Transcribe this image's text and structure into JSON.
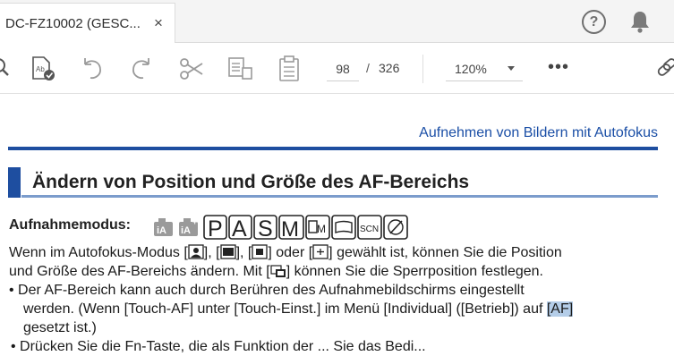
{
  "tab": {
    "title": "DC-FZ10002 (GESC...",
    "close": "×"
  },
  "header_icons": {
    "help": "?",
    "notifications": "bell-icon"
  },
  "toolbar": {
    "page_current": "98",
    "page_separator": "/",
    "page_total": "326",
    "zoom": "120%",
    "more": "•••",
    "icons": [
      "search-icon",
      "fill-sign-icon",
      "undo-icon",
      "redo-icon",
      "scissors-icon",
      "organize-pages-icon",
      "clipboard-icon",
      "link-icon"
    ]
  },
  "document": {
    "running_head": "Aufnehmen von Bildern mit Autofokus",
    "section_title": "Ändern von Position und Größe des AF-Bereichs",
    "mode_label": "Aufnahmemodus:",
    "mode_icons": [
      "iA",
      "iA+",
      "P",
      "A",
      "S",
      "M",
      "movie-M",
      "panorama",
      "SCN",
      "creative"
    ],
    "line1_a": "Wenn im Autofokus-Modus [",
    "line1_b": "], [",
    "line1_c": "], [",
    "line1_d": "] oder [",
    "line1_e": "] gewählt ist, können Sie die Position",
    "line2_a": "und Größe des AF-Bereichs ändern. Mit [",
    "line2_b": "] können Sie die Sperrposition festlegen.",
    "bullet1_line1": "• Der AF-Bereich kann auch durch Berühren des Aufnahmebildschirms eingestellt",
    "bullet1_line2_a": "werden. (Wenn [Touch-AF] unter [Touch-Einst.] im Menü [Individual] ([Betrieb]) auf ",
    "bullet1_line2_hl": "[AF]",
    "bullet1_line3": "gesetzt ist.)",
    "bullet2_partial": "• Drücken Sie die Fn-Taste, die als Funktion der ... Sie das Bedi..."
  }
}
